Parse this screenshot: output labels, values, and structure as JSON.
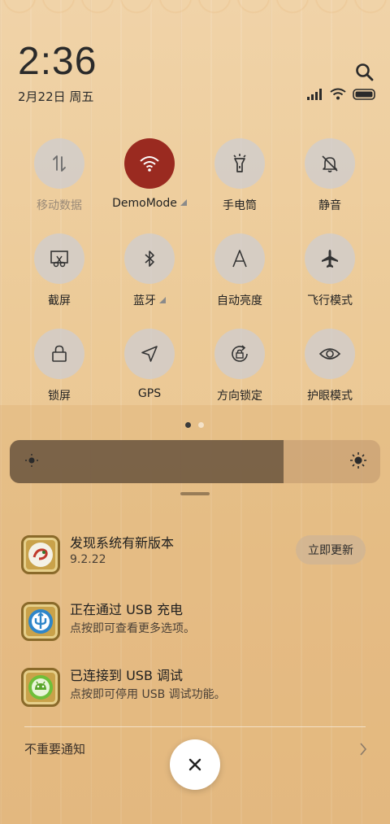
{
  "status": {
    "time": "2:36",
    "date": "2月22日 周五"
  },
  "toggles": [
    {
      "label": "移动数据",
      "icon": "mobile-data-icon",
      "state": "disabled"
    },
    {
      "label": "DemoMode",
      "icon": "wifi-icon",
      "state": "on",
      "has_more": true
    },
    {
      "label": "手电筒",
      "icon": "flashlight-icon",
      "state": "off"
    },
    {
      "label": "静音",
      "icon": "mute-bell-icon",
      "state": "off"
    },
    {
      "label": "截屏",
      "icon": "screenshot-icon",
      "state": "off"
    },
    {
      "label": "蓝牙",
      "icon": "bluetooth-icon",
      "state": "off",
      "has_more": true
    },
    {
      "label": "自动亮度",
      "icon": "auto-brightness-icon",
      "state": "off"
    },
    {
      "label": "飞行模式",
      "icon": "airplane-icon",
      "state": "off"
    },
    {
      "label": "锁屏",
      "icon": "lock-icon",
      "state": "off"
    },
    {
      "label": "GPS",
      "icon": "location-arrow-icon",
      "state": "off"
    },
    {
      "label": "方向锁定",
      "icon": "rotation-lock-icon",
      "state": "off"
    },
    {
      "label": "护眼模式",
      "icon": "eye-icon",
      "state": "off"
    }
  ],
  "pager": {
    "current": 1,
    "total": 2
  },
  "brightness": {
    "level": 0.74
  },
  "notifications": [
    {
      "title": "发现系统有新版本",
      "sub": "9.2.22",
      "action": "立即更新",
      "icon": "updater-app-icon"
    },
    {
      "title": "正在通过 USB 充电",
      "sub": "点按即可查看更多选项。",
      "icon": "usb-icon"
    },
    {
      "title": "已连接到 USB 调试",
      "sub": "点按即可停用 USB 调试功能。",
      "icon": "android-icon"
    }
  ],
  "minor_notifications_label": "不重要通知",
  "colors": {
    "accent_active": "#9a2a20",
    "toggle_bg": "#cdcdd2"
  }
}
